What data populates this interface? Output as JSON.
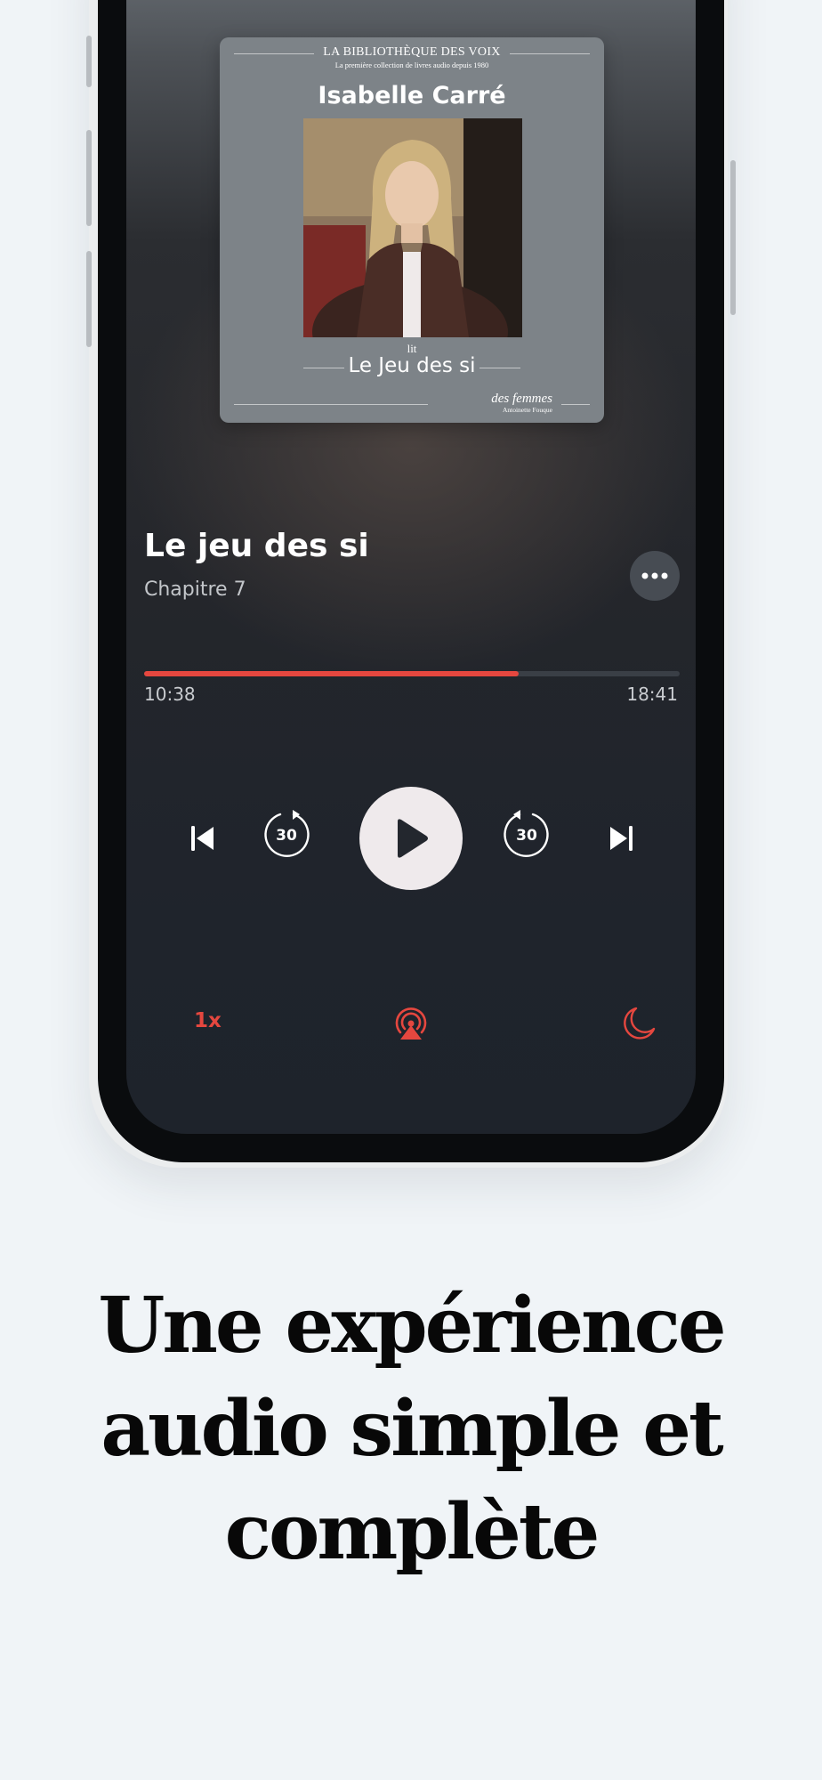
{
  "cover": {
    "series": "LA BIBLIOTHÈQUE DES VOIX",
    "tagline": "La première collection de livres audio depuis 1980",
    "narrator": "Isabelle Carré",
    "reads_label": "lit",
    "book_title": "Le Jeu des si",
    "publisher": "des femmes",
    "publisher_sub": "Antoinette Fouque"
  },
  "player": {
    "title": "Le jeu des si",
    "chapter": "Chapitre 7",
    "elapsed": "10:38",
    "total": "18:41",
    "progress": 0.7,
    "skip_back_seconds": "30",
    "skip_forward_seconds": "30",
    "speed": "1x",
    "accent_color": "#e5473f"
  },
  "headline": {
    "line1": "Une expérience",
    "line2": "audio simple et",
    "line3": "complète"
  }
}
